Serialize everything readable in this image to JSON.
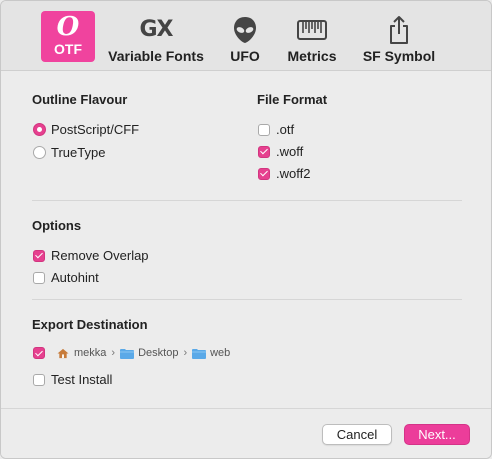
{
  "toolbar": {
    "tabs": [
      {
        "label": "OTF",
        "icon": "otf-icon",
        "active": true
      },
      {
        "label": "Variable Fonts",
        "icon": "gx-icon",
        "glyph": "GX"
      },
      {
        "label": "UFO",
        "icon": "alien-icon"
      },
      {
        "label": "Metrics",
        "icon": "ruler-icon"
      },
      {
        "label": "SF Symbol",
        "icon": "share-icon"
      }
    ],
    "otf_glyph": "O",
    "accent_color": "#f0439e"
  },
  "outline_flavour": {
    "title": "Outline Flavour",
    "options": [
      {
        "label": "PostScript/CFF",
        "selected": true
      },
      {
        "label": "TrueType",
        "selected": false
      }
    ]
  },
  "file_format": {
    "title": "File Format",
    "options": [
      {
        "label": ".otf",
        "checked": false
      },
      {
        "label": ".woff",
        "checked": true
      },
      {
        "label": ".woff2",
        "checked": true
      }
    ]
  },
  "options": {
    "title": "Options",
    "items": [
      {
        "label": "Remove Overlap",
        "checked": true
      },
      {
        "label": "Autohint",
        "checked": false
      }
    ]
  },
  "export": {
    "title": "Export Destination",
    "path_checked": true,
    "path": [
      "mekka",
      "Desktop",
      "web"
    ],
    "test_install": {
      "label": "Test Install",
      "checked": false
    }
  },
  "footer": {
    "cancel_label": "Cancel",
    "next_label": "Next..."
  }
}
